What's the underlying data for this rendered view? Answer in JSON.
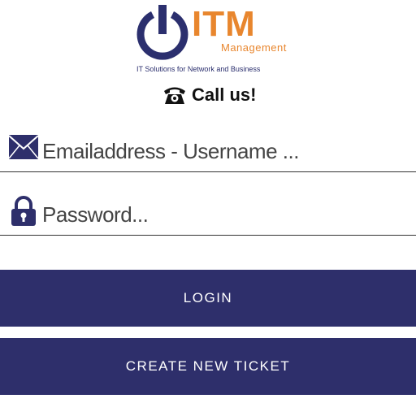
{
  "logo": {
    "name": "ITM",
    "subtitle": "Management",
    "tagline": "IT Solutions for Network and Business",
    "power_icon": "power-icon",
    "colors": {
      "brand_blue": "#2b2f6e",
      "brand_orange": "#e8862e"
    }
  },
  "call": {
    "label": "Call us!",
    "icon": "phone-icon"
  },
  "form": {
    "email": {
      "placeholder": "Emailaddress - Username ...",
      "value": "",
      "icon": "envelope-icon"
    },
    "password": {
      "placeholder": "Password...",
      "value": "",
      "icon": "lock-icon"
    }
  },
  "buttons": {
    "login": "LOGIN",
    "create_ticket": "CREATE NEW TICKET",
    "color": "#2e2f6b"
  }
}
